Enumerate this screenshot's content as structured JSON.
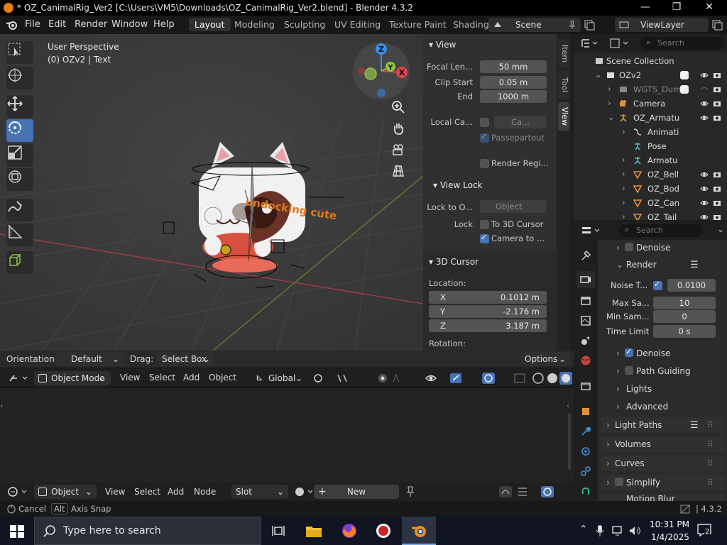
{
  "titlebar": {
    "title": "* OZ_CanimalRig_Ver2 [C:\\Users\\VM5\\Downloads\\OZ_CanimalRig_Ver2.blend] - Blender 4.3.2",
    "minimize": "—",
    "maximize": "❐",
    "close": "✕"
  },
  "menubar": {
    "items": [
      "File",
      "Edit",
      "Render",
      "Window",
      "Help"
    ],
    "workspaces": [
      "Layout",
      "Modeling",
      "Sculpting",
      "UV Editing",
      "Texture Paint",
      "Shading"
    ],
    "scene": "Scene",
    "view_layer": "ViewLayer"
  },
  "viewport": {
    "perspective": "User Perspective",
    "object_info": "(0) OZv2 | Text",
    "scene_text": "undocking cute",
    "gizmo": {
      "x": "X",
      "y": "Y",
      "z": "Z"
    },
    "colors": {
      "x_axis": "#e0444f",
      "y_axis": "#8cc63e",
      "z_axis": "#3a8ee6"
    }
  },
  "npanel": {
    "tabs": [
      "Item",
      "Tool",
      "View"
    ],
    "view": {
      "header": "View",
      "focal_length_label": "Focal Len...",
      "focal_length": "50 mm",
      "clip_start_label": "Clip Start",
      "clip_start": "0.05 m",
      "end_label": "End",
      "end": "1000 m",
      "local_camera_label": "Local Ca...",
      "local_camera_value": "Ca...",
      "passepartout": "Passepartout",
      "render_region": "Render Regi..."
    },
    "view_lock": {
      "header": "View Lock",
      "lock_to_object_label": "Lock to O...",
      "lock_to_object_placeholder": "Object",
      "lock_label": "Lock",
      "to_3d_cursor": "To 3D Cursor",
      "camera_to_view": "Camera to ..."
    },
    "cursor": {
      "header": "3D Cursor",
      "location_label": "Location:",
      "x_label": "X",
      "x": "0.1012 m",
      "y_label": "Y",
      "y": "-2.176 m",
      "z_label": "Z",
      "z": "3.187 m",
      "rotation_label": "Rotation:"
    }
  },
  "tool_header": {
    "orientation_label": "Orientation:",
    "orientation": "Default",
    "drag_label": "Drag:",
    "drag": "Select Box",
    "options": "Options"
  },
  "vp_header": {
    "mode": "Object Mode",
    "menus": [
      "View",
      "Select",
      "Add",
      "Object"
    ],
    "transform": "Global"
  },
  "shader_header": {
    "type": "Object",
    "menus": [
      "View",
      "Select",
      "Add",
      "Node"
    ],
    "slot": "Slot",
    "new": "New"
  },
  "outliner": {
    "search_placeholder": "Search",
    "rows": [
      {
        "name": "Scene Collection"
      },
      {
        "name": "OZv2"
      },
      {
        "name": "WGTS_Dum"
      },
      {
        "name": "Camera"
      },
      {
        "name": "OZ_Armatu"
      },
      {
        "name": "Animati"
      },
      {
        "name": "Pose"
      },
      {
        "name": "Armatu"
      },
      {
        "name": "OZ_Bell"
      },
      {
        "name": "OZ_Bod"
      },
      {
        "name": "OZ_Can"
      },
      {
        "name": "OZ_Tail"
      }
    ]
  },
  "properties": {
    "search_placeholder": "Search",
    "denoise_top": "Denoise",
    "render": "Render",
    "noise_threshold_label": "Noise T...",
    "noise_threshold": "0.0100",
    "max_samples_label": "Max Sa...",
    "max_samples": "10",
    "min_samples_label": "Min Sam...",
    "min_samples": "0",
    "time_limit_label": "Time Limit",
    "time_limit": "0 s",
    "denoise": "Denoise",
    "path_guiding": "Path Guiding",
    "lights": "Lights",
    "advanced": "Advanced",
    "light_paths": "Light Paths",
    "volumes": "Volumes",
    "curves": "Curves",
    "simplify": "Simplify",
    "motion_blur": "Motion Blur"
  },
  "statusbar": {
    "cancel": "Cancel",
    "alt_key": "Alt",
    "axis_snap": "Axis Snap",
    "version": "4.3.2"
  },
  "taskbar": {
    "search_placeholder": "Type here to search",
    "time": "10:31 PM",
    "date": "1/4/2025",
    "notifications": "2"
  }
}
